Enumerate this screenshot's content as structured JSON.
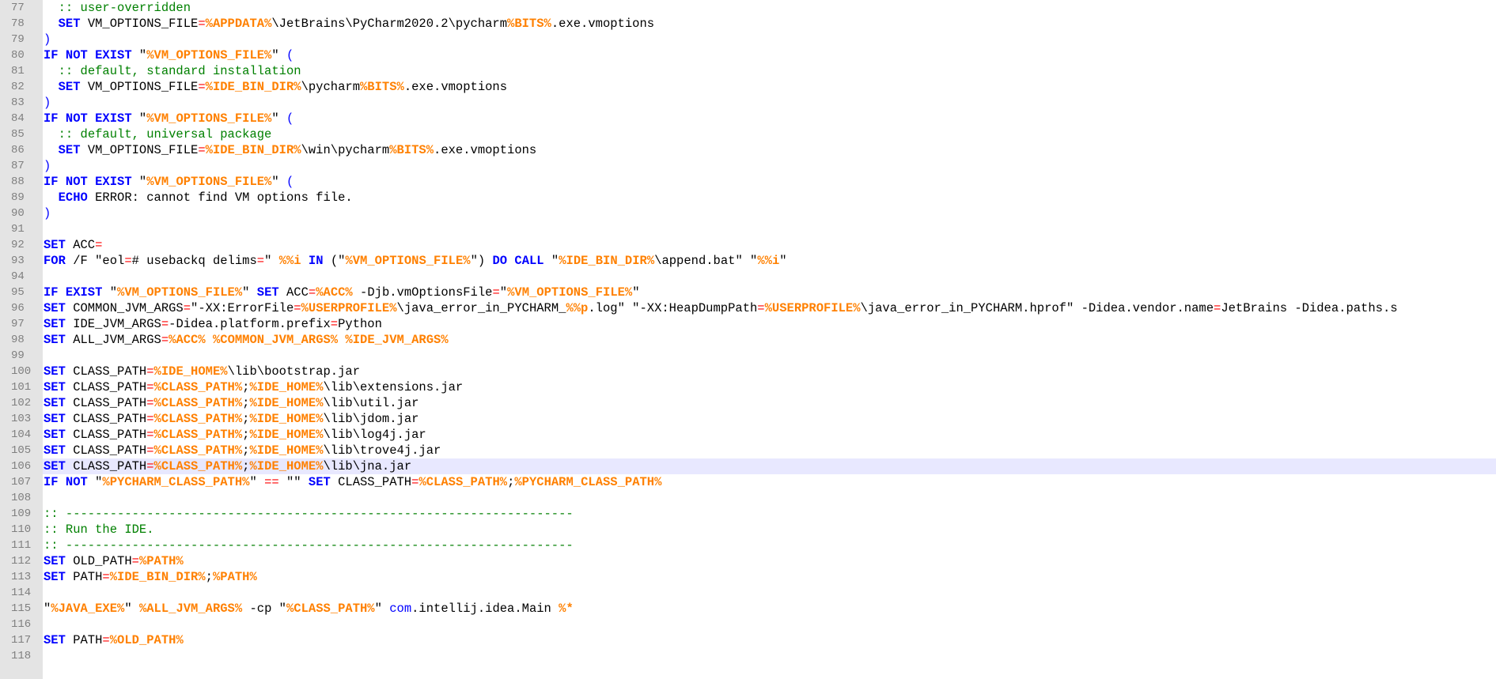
{
  "colors": {
    "keyword": "#0000ff",
    "variable": "#ff8000",
    "operator": "#ff0000",
    "comment": "#008000",
    "text": "#000000",
    "gutter": "#e4e4e4",
    "current_line": "#e8e8ff"
  },
  "editor": {
    "current_line": 106,
    "lines": [
      {
        "n": "77",
        "tokens": [
          [
            "txt",
            "  "
          ],
          [
            "cmt",
            ":: user-overridden"
          ]
        ]
      },
      {
        "n": "78",
        "tokens": [
          [
            "txt",
            "  "
          ],
          [
            "kw",
            "SET"
          ],
          [
            "txt",
            " VM_OPTIONS_FILE"
          ],
          [
            "op",
            "="
          ],
          [
            "var",
            "%APPDATA%"
          ],
          [
            "txt",
            "\\JetBrains\\PyCharm2020.2\\pycharm"
          ],
          [
            "var",
            "%BITS%"
          ],
          [
            "txt",
            ".exe.vmoptions"
          ]
        ]
      },
      {
        "n": "79",
        "tokens": [
          [
            "par",
            ")"
          ]
        ]
      },
      {
        "n": "80",
        "tokens": [
          [
            "kw",
            "IF NOT EXIST"
          ],
          [
            "txt",
            " \""
          ],
          [
            "var",
            "%VM_OPTIONS_FILE%"
          ],
          [
            "txt",
            "\" "
          ],
          [
            "par",
            "("
          ]
        ]
      },
      {
        "n": "81",
        "tokens": [
          [
            "txt",
            "  "
          ],
          [
            "cmt",
            ":: default, standard installation"
          ]
        ]
      },
      {
        "n": "82",
        "tokens": [
          [
            "txt",
            "  "
          ],
          [
            "kw",
            "SET"
          ],
          [
            "txt",
            " VM_OPTIONS_FILE"
          ],
          [
            "op",
            "="
          ],
          [
            "var",
            "%IDE_BIN_DIR%"
          ],
          [
            "txt",
            "\\pycharm"
          ],
          [
            "var",
            "%BITS%"
          ],
          [
            "txt",
            ".exe.vmoptions"
          ]
        ]
      },
      {
        "n": "83",
        "tokens": [
          [
            "par",
            ")"
          ]
        ]
      },
      {
        "n": "84",
        "tokens": [
          [
            "kw",
            "IF NOT EXIST"
          ],
          [
            "txt",
            " \""
          ],
          [
            "var",
            "%VM_OPTIONS_FILE%"
          ],
          [
            "txt",
            "\" "
          ],
          [
            "par",
            "("
          ]
        ]
      },
      {
        "n": "85",
        "tokens": [
          [
            "txt",
            "  "
          ],
          [
            "cmt",
            ":: default, universal package"
          ]
        ]
      },
      {
        "n": "86",
        "tokens": [
          [
            "txt",
            "  "
          ],
          [
            "kw",
            "SET"
          ],
          [
            "txt",
            " VM_OPTIONS_FILE"
          ],
          [
            "op",
            "="
          ],
          [
            "var",
            "%IDE_BIN_DIR%"
          ],
          [
            "txt",
            "\\win\\pycharm"
          ],
          [
            "var",
            "%BITS%"
          ],
          [
            "txt",
            ".exe.vmoptions"
          ]
        ]
      },
      {
        "n": "87",
        "tokens": [
          [
            "par",
            ")"
          ]
        ]
      },
      {
        "n": "88",
        "tokens": [
          [
            "kw",
            "IF NOT EXIST"
          ],
          [
            "txt",
            " \""
          ],
          [
            "var",
            "%VM_OPTIONS_FILE%"
          ],
          [
            "txt",
            "\" "
          ],
          [
            "par",
            "("
          ]
        ]
      },
      {
        "n": "89",
        "tokens": [
          [
            "txt",
            "  "
          ],
          [
            "kw",
            "ECHO"
          ],
          [
            "txt",
            " ERROR: cannot find VM options file."
          ]
        ]
      },
      {
        "n": "90",
        "tokens": [
          [
            "par",
            ")"
          ]
        ]
      },
      {
        "n": "91",
        "tokens": []
      },
      {
        "n": "92",
        "tokens": [
          [
            "kw",
            "SET"
          ],
          [
            "txt",
            " ACC"
          ],
          [
            "op",
            "="
          ]
        ]
      },
      {
        "n": "93",
        "tokens": [
          [
            "kw",
            "FOR"
          ],
          [
            "txt",
            " /F \"eol"
          ],
          [
            "op",
            "="
          ],
          [
            "txt",
            "# usebackq delims"
          ],
          [
            "op",
            "="
          ],
          [
            "txt",
            "\" "
          ],
          [
            "var",
            "%%i"
          ],
          [
            "txt",
            " "
          ],
          [
            "kw",
            "IN"
          ],
          [
            "txt",
            " (\""
          ],
          [
            "var",
            "%VM_OPTIONS_FILE%"
          ],
          [
            "txt",
            "\") "
          ],
          [
            "kw",
            "DO CALL"
          ],
          [
            "txt",
            " \""
          ],
          [
            "var",
            "%IDE_BIN_DIR%"
          ],
          [
            "txt",
            "\\append.bat\" \""
          ],
          [
            "var",
            "%%i"
          ],
          [
            "txt",
            "\""
          ]
        ]
      },
      {
        "n": "94",
        "tokens": []
      },
      {
        "n": "95",
        "tokens": [
          [
            "kw",
            "IF EXIST"
          ],
          [
            "txt",
            " \""
          ],
          [
            "var",
            "%VM_OPTIONS_FILE%"
          ],
          [
            "txt",
            "\" "
          ],
          [
            "kw",
            "SET"
          ],
          [
            "txt",
            " ACC"
          ],
          [
            "op",
            "="
          ],
          [
            "var",
            "%ACC%"
          ],
          [
            "txt",
            " -Djb.vmOptionsFile"
          ],
          [
            "op",
            "="
          ],
          [
            "txt",
            "\""
          ],
          [
            "var",
            "%VM_OPTIONS_FILE%"
          ],
          [
            "txt",
            "\""
          ]
        ]
      },
      {
        "n": "96",
        "tokens": [
          [
            "kw",
            "SET"
          ],
          [
            "txt",
            " COMMON_JVM_ARGS"
          ],
          [
            "op",
            "="
          ],
          [
            "txt",
            "\"-XX:ErrorFile"
          ],
          [
            "op",
            "="
          ],
          [
            "var",
            "%USERPROFILE%"
          ],
          [
            "txt",
            "\\java_error_in_PYCHARM_"
          ],
          [
            "var",
            "%%p"
          ],
          [
            "txt",
            ".log\" \"-XX:HeapDumpPath"
          ],
          [
            "op",
            "="
          ],
          [
            "var",
            "%USERPROFILE%"
          ],
          [
            "txt",
            "\\java_error_in_PYCHARM.hprof\" -Didea.vendor.name"
          ],
          [
            "op",
            "="
          ],
          [
            "txt",
            "JetBrains -Didea.paths.s"
          ]
        ]
      },
      {
        "n": "97",
        "tokens": [
          [
            "kw",
            "SET"
          ],
          [
            "txt",
            " IDE_JVM_ARGS"
          ],
          [
            "op",
            "="
          ],
          [
            "txt",
            "-Didea.platform.prefix"
          ],
          [
            "op",
            "="
          ],
          [
            "txt",
            "Python"
          ]
        ]
      },
      {
        "n": "98",
        "tokens": [
          [
            "kw",
            "SET"
          ],
          [
            "txt",
            " ALL_JVM_ARGS"
          ],
          [
            "op",
            "="
          ],
          [
            "var",
            "%ACC%"
          ],
          [
            "txt",
            " "
          ],
          [
            "var",
            "%COMMON_JVM_ARGS%"
          ],
          [
            "txt",
            " "
          ],
          [
            "var",
            "%IDE_JVM_ARGS%"
          ]
        ]
      },
      {
        "n": "99",
        "tokens": []
      },
      {
        "n": "100",
        "tokens": [
          [
            "kw",
            "SET"
          ],
          [
            "txt",
            " CLASS_PATH"
          ],
          [
            "op",
            "="
          ],
          [
            "var",
            "%IDE_HOME%"
          ],
          [
            "txt",
            "\\lib\\bootstrap.jar"
          ]
        ]
      },
      {
        "n": "101",
        "tokens": [
          [
            "kw",
            "SET"
          ],
          [
            "txt",
            " CLASS_PATH"
          ],
          [
            "op",
            "="
          ],
          [
            "var",
            "%CLASS_PATH%"
          ],
          [
            "txt",
            ";"
          ],
          [
            "var",
            "%IDE_HOME%"
          ],
          [
            "txt",
            "\\lib\\extensions.jar"
          ]
        ]
      },
      {
        "n": "102",
        "tokens": [
          [
            "kw",
            "SET"
          ],
          [
            "txt",
            " CLASS_PATH"
          ],
          [
            "op",
            "="
          ],
          [
            "var",
            "%CLASS_PATH%"
          ],
          [
            "txt",
            ";"
          ],
          [
            "var",
            "%IDE_HOME%"
          ],
          [
            "txt",
            "\\lib\\util.jar"
          ]
        ]
      },
      {
        "n": "103",
        "tokens": [
          [
            "kw",
            "SET"
          ],
          [
            "txt",
            " CLASS_PATH"
          ],
          [
            "op",
            "="
          ],
          [
            "var",
            "%CLASS_PATH%"
          ],
          [
            "txt",
            ";"
          ],
          [
            "var",
            "%IDE_HOME%"
          ],
          [
            "txt",
            "\\lib\\jdom.jar"
          ]
        ]
      },
      {
        "n": "104",
        "tokens": [
          [
            "kw",
            "SET"
          ],
          [
            "txt",
            " CLASS_PATH"
          ],
          [
            "op",
            "="
          ],
          [
            "var",
            "%CLASS_PATH%"
          ],
          [
            "txt",
            ";"
          ],
          [
            "var",
            "%IDE_HOME%"
          ],
          [
            "txt",
            "\\lib\\log4j.jar"
          ]
        ]
      },
      {
        "n": "105",
        "tokens": [
          [
            "kw",
            "SET"
          ],
          [
            "txt",
            " CLASS_PATH"
          ],
          [
            "op",
            "="
          ],
          [
            "var",
            "%CLASS_PATH%"
          ],
          [
            "txt",
            ";"
          ],
          [
            "var",
            "%IDE_HOME%"
          ],
          [
            "txt",
            "\\lib\\trove4j.jar"
          ]
        ]
      },
      {
        "n": "106",
        "tokens": [
          [
            "kw",
            "SET"
          ],
          [
            "txt",
            " CLASS_PATH"
          ],
          [
            "op",
            "="
          ],
          [
            "var",
            "%CLASS_PATH%"
          ],
          [
            "txt",
            ";"
          ],
          [
            "var",
            "%IDE_HOME%"
          ],
          [
            "txt",
            "\\lib\\jna.jar"
          ]
        ]
      },
      {
        "n": "107",
        "tokens": [
          [
            "kw",
            "IF NOT"
          ],
          [
            "txt",
            " \""
          ],
          [
            "var",
            "%PYCHARM_CLASS_PATH%"
          ],
          [
            "txt",
            "\" "
          ],
          [
            "op",
            "=="
          ],
          [
            "txt",
            " \"\" "
          ],
          [
            "kw",
            "SET"
          ],
          [
            "txt",
            " CLASS_PATH"
          ],
          [
            "op",
            "="
          ],
          [
            "var",
            "%CLASS_PATH%"
          ],
          [
            "txt",
            ";"
          ],
          [
            "var",
            "%PYCHARM_CLASS_PATH%"
          ]
        ]
      },
      {
        "n": "108",
        "tokens": []
      },
      {
        "n": "109",
        "tokens": [
          [
            "cmt",
            ":: ---------------------------------------------------------------------"
          ]
        ]
      },
      {
        "n": "110",
        "tokens": [
          [
            "cmt",
            ":: Run the IDE."
          ]
        ]
      },
      {
        "n": "111",
        "tokens": [
          [
            "cmt",
            ":: ---------------------------------------------------------------------"
          ]
        ]
      },
      {
        "n": "112",
        "tokens": [
          [
            "kw",
            "SET"
          ],
          [
            "txt",
            " OLD_PATH"
          ],
          [
            "op",
            "="
          ],
          [
            "var",
            "%PATH%"
          ]
        ]
      },
      {
        "n": "113",
        "tokens": [
          [
            "kw",
            "SET"
          ],
          [
            "txt",
            " PATH"
          ],
          [
            "op",
            "="
          ],
          [
            "var",
            "%IDE_BIN_DIR%"
          ],
          [
            "txt",
            ";"
          ],
          [
            "var",
            "%PATH%"
          ]
        ]
      },
      {
        "n": "114",
        "tokens": []
      },
      {
        "n": "115",
        "tokens": [
          [
            "txt",
            "\""
          ],
          [
            "var",
            "%JAVA_EXE%"
          ],
          [
            "txt",
            "\" "
          ],
          [
            "var",
            "%ALL_JVM_ARGS%"
          ],
          [
            "txt",
            " -cp \""
          ],
          [
            "var",
            "%CLASS_PATH%"
          ],
          [
            "txt",
            "\" "
          ],
          [
            "kwn",
            "com"
          ],
          [
            "txt",
            ".intellij.idea.Main "
          ],
          [
            "var",
            "%*"
          ]
        ]
      },
      {
        "n": "116",
        "tokens": []
      },
      {
        "n": "117",
        "tokens": [
          [
            "kw",
            "SET"
          ],
          [
            "txt",
            " PATH"
          ],
          [
            "op",
            "="
          ],
          [
            "var",
            "%OLD_PATH%"
          ]
        ]
      },
      {
        "n": "118",
        "tokens": []
      }
    ]
  }
}
